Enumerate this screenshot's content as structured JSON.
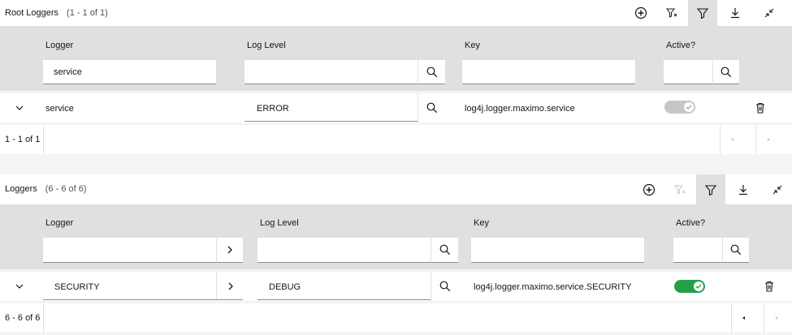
{
  "root": {
    "title": "Root Loggers",
    "count": "(1 - 1 of 1)",
    "columns": {
      "logger": "Logger",
      "log_level": "Log Level",
      "key": "Key",
      "active": "Active?"
    },
    "filter": {
      "logger": "service",
      "log_level": "",
      "key": "",
      "active": ""
    },
    "row": {
      "logger": "service",
      "log_level": "ERROR",
      "key": "log4j.logger.maximo.service",
      "active": true
    },
    "pagination": "1 - 1 of 1"
  },
  "loggers": {
    "title": "Loggers",
    "count": "(6 - 6 of 6)",
    "columns": {
      "logger": "Logger",
      "log_level": "Log Level",
      "key": "Key",
      "active": "Active?"
    },
    "filter": {
      "logger": "",
      "log_level": "",
      "key": "",
      "active": ""
    },
    "row": {
      "logger": "SECURITY",
      "log_level": "DEBUG",
      "key": "log4j.logger.maximo.service.SECURITY",
      "active": true
    },
    "pagination": "6 - 6 of 6"
  },
  "colors": {
    "toggle_on": "#24a148",
    "toggle_off": "#c6c6c6",
    "header_bg": "#e0e0e0"
  }
}
